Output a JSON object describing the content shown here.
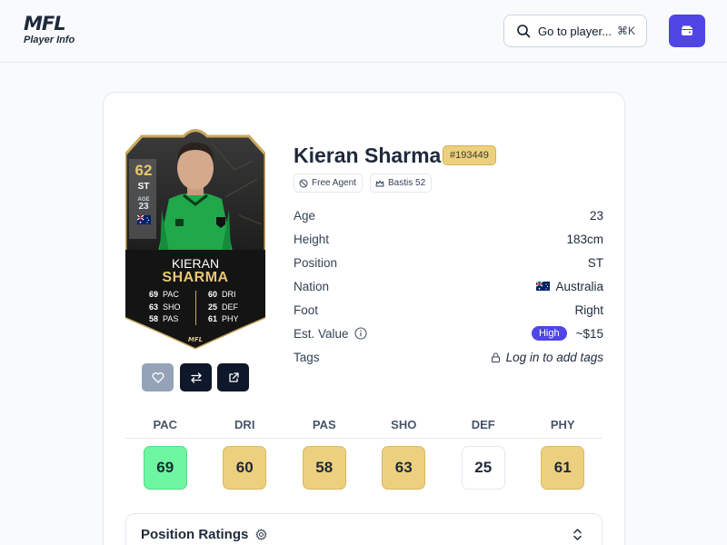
{
  "app": {
    "logo_mark": "MFL",
    "logo_subtitle": "Player Info",
    "search_label": "Go to player...",
    "search_shortcut": "⌘K",
    "wallet_icon": "wallet-icon",
    "accent": "#4f46e5"
  },
  "player_card": {
    "overall": "62",
    "position": "ST",
    "age_label": "AGE",
    "age": "23",
    "first_name": "KIERAN",
    "last_name": "SHARMA",
    "stats_left": [
      {
        "value": "69",
        "label": "PAC"
      },
      {
        "value": "63",
        "label": "SHO"
      },
      {
        "value": "58",
        "label": "PAS"
      }
    ],
    "stats_right": [
      {
        "value": "60",
        "label": "DRI"
      },
      {
        "value": "25",
        "label": "DEF"
      },
      {
        "value": "61",
        "label": "PHY"
      }
    ]
  },
  "player": {
    "name": "Kieran Sharma",
    "id": "#193449",
    "status": "Free Agent",
    "club": "Bastis 52"
  },
  "info": {
    "age": {
      "label": "Age",
      "value": "23"
    },
    "height": {
      "label": "Height",
      "value": "183cm"
    },
    "position": {
      "label": "Position",
      "value": "ST"
    },
    "nation": {
      "label": "Nation",
      "value": "Australia"
    },
    "foot": {
      "label": "Foot",
      "value": "Right"
    },
    "value": {
      "label": "Est. Value",
      "badge": "High",
      "amount": "~$15"
    },
    "tags": {
      "label": "Tags",
      "value": "Log in to add tags"
    }
  },
  "attributes": [
    {
      "label": "PAC",
      "value": "69",
      "color": "#6ff6a0"
    },
    {
      "label": "DRI",
      "value": "60",
      "color": "#ecd080"
    },
    {
      "label": "PAS",
      "value": "58",
      "color": "#ecd080"
    },
    {
      "label": "SHO",
      "value": "63",
      "color": "#ecd080"
    },
    {
      "label": "DEF",
      "value": "25",
      "color": "#ffffff"
    },
    {
      "label": "PHY",
      "value": "61",
      "color": "#ecd080"
    }
  ],
  "position_ratings": {
    "title": "Position Ratings"
  }
}
